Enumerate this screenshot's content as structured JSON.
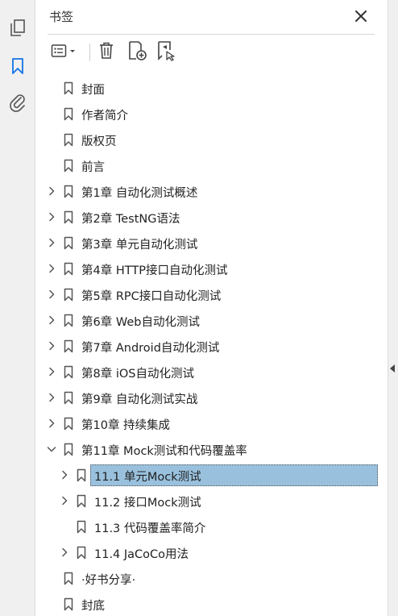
{
  "panel": {
    "title": "书签",
    "toolbar": {
      "options_icon": "options-list-icon",
      "delete_icon": "trash-icon",
      "new_bookmark_icon": "new-bookmark-icon",
      "find_bookmark_icon": "find-bookmark-icon"
    }
  },
  "rail": {
    "items": [
      {
        "icon": "page-thumbnails-icon"
      },
      {
        "icon": "bookmark-icon",
        "active": true
      },
      {
        "icon": "attachment-icon"
      }
    ]
  },
  "bookmarks": [
    {
      "label": "封面",
      "level": 0,
      "expander": "none"
    },
    {
      "label": "作者简介",
      "level": 0,
      "expander": "none"
    },
    {
      "label": "版权页",
      "level": 0,
      "expander": "none"
    },
    {
      "label": "前言",
      "level": 0,
      "expander": "none"
    },
    {
      "label": "第1章 自动化测试概述",
      "level": 0,
      "expander": "collapsed"
    },
    {
      "label": "第2章 TestNG语法",
      "level": 0,
      "expander": "collapsed"
    },
    {
      "label": "第3章 单元自动化测试",
      "level": 0,
      "expander": "collapsed"
    },
    {
      "label": "第4章 HTTP接口自动化测试",
      "level": 0,
      "expander": "collapsed"
    },
    {
      "label": "第5章 RPC接口自动化测试",
      "level": 0,
      "expander": "collapsed"
    },
    {
      "label": "第6章 Web自动化测试",
      "level": 0,
      "expander": "collapsed"
    },
    {
      "label": "第7章 Android自动化测试",
      "level": 0,
      "expander": "collapsed"
    },
    {
      "label": "第8章 iOS自动化测试",
      "level": 0,
      "expander": "collapsed"
    },
    {
      "label": "第9章 自动化测试实战",
      "level": 0,
      "expander": "collapsed"
    },
    {
      "label": "第10章 持续集成",
      "level": 0,
      "expander": "collapsed"
    },
    {
      "label": "第11章 Mock测试和代码覆盖率",
      "level": 0,
      "expander": "expanded"
    },
    {
      "label": "11.1 单元Mock测试",
      "level": 1,
      "expander": "collapsed",
      "selected": true
    },
    {
      "label": "11.2 接口Mock测试",
      "level": 1,
      "expander": "collapsed"
    },
    {
      "label": "11.3 代码覆盖率简介",
      "level": 1,
      "expander": "none"
    },
    {
      "label": "11.4 JaCoCo用法",
      "level": 1,
      "expander": "collapsed"
    },
    {
      "label": "·好书分享·",
      "level": 0,
      "expander": "none"
    },
    {
      "label": "封底",
      "level": 0,
      "expander": "none"
    }
  ],
  "colors": {
    "selection": "#99c1dd",
    "rail_active": "#1473e6"
  }
}
